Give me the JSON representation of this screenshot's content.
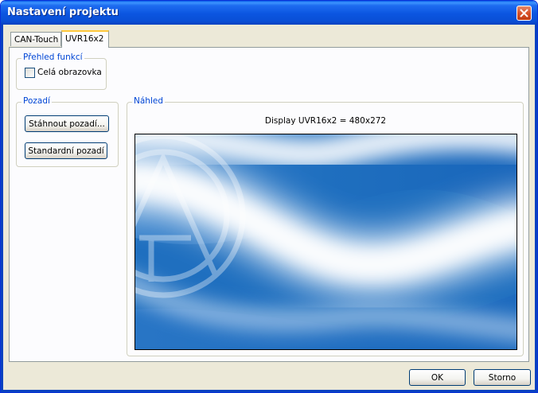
{
  "window": {
    "title": "Nastavení projektu"
  },
  "tabs": [
    {
      "label": "CAN-Touch",
      "active": false
    },
    {
      "label": "UVR16x2",
      "active": true
    }
  ],
  "overview_group": {
    "label": "Přehled funkcí",
    "checkbox": {
      "label": "Celá obrazovka",
      "checked": false
    }
  },
  "background_group": {
    "label": "Pozadí",
    "download_button": "Stáhnout pozadí...",
    "standard_button": "Standardní pozadí"
  },
  "preview_group": {
    "label": "Náhled",
    "caption": "Display UVR16x2 = 480x272"
  },
  "footer": {
    "ok_label": "OK",
    "cancel_label": "Storno"
  },
  "colors": {
    "accent": "#0a55e0",
    "preview_blue": "#1f6fbf"
  }
}
